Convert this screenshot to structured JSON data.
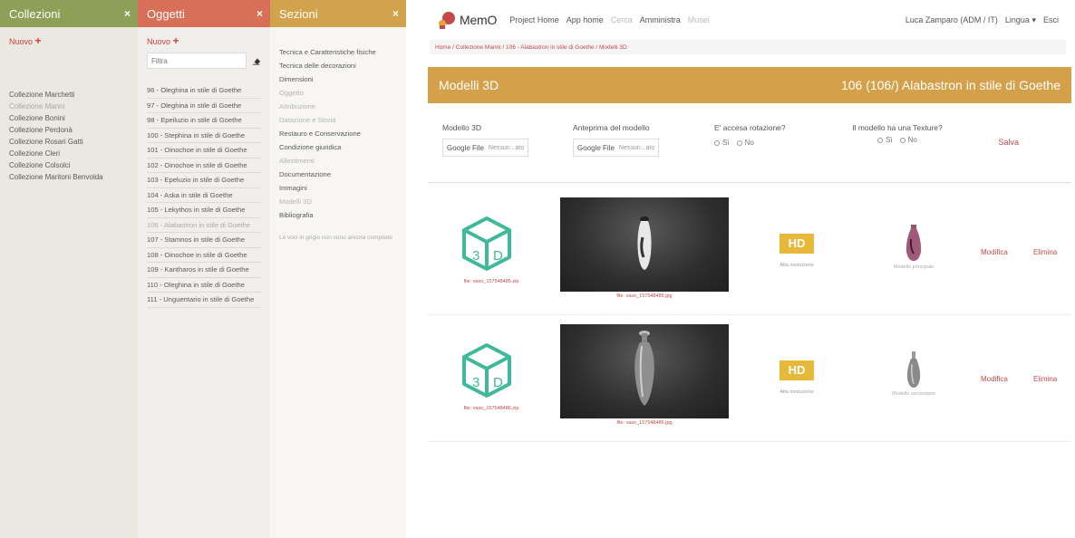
{
  "columns": {
    "collezioni": {
      "title": "Collezioni",
      "close": "×",
      "new_label": "Nuovo",
      "items": [
        {
          "label": "Collezione Marchetti",
          "muted": false
        },
        {
          "label": "Collezione Manni",
          "muted": true
        },
        {
          "label": "Collezione Bonini",
          "muted": false
        },
        {
          "label": "Collezione Perdonà",
          "muted": false
        },
        {
          "label": "Collezione Rosari Gatti",
          "muted": false
        },
        {
          "label": "Collezione Cleri",
          "muted": false
        },
        {
          "label": "Collezione Colsolci",
          "muted": false
        },
        {
          "label": "Collezione Maritoni Benvolda",
          "muted": false
        }
      ]
    },
    "oggetti": {
      "title": "Oggetti",
      "close": "×",
      "new_label": "Nuovo",
      "search_placeholder": "Filtra",
      "items": [
        {
          "label": "96 - Oleghina in stile di Goethe",
          "muted": false
        },
        {
          "label": "97 - Oleghina in stile di Goethe",
          "muted": false
        },
        {
          "label": "98 - Epeiluzio in stile di Goethe",
          "muted": false
        },
        {
          "label": "100 - Stephina in stile di Goethe",
          "muted": false
        },
        {
          "label": "101 - Oinochoe in stile di Goethe",
          "muted": false
        },
        {
          "label": "102 - Oinochoe in stile di Goethe",
          "muted": false
        },
        {
          "label": "103 - Epeluzio in stile di Goethe",
          "muted": false
        },
        {
          "label": "104 - Aska in stile di Goethe",
          "muted": false
        },
        {
          "label": "105 - Lekythos in stile di Goethe",
          "muted": false
        },
        {
          "label": "106 - Alabastron in stile di Goethe",
          "muted": true
        },
        {
          "label": "107 - Stamnos in stile di Goethe",
          "muted": false
        },
        {
          "label": "108 - Oinochoe in stile di Goethe",
          "muted": false
        },
        {
          "label": "109 - Kantharos in stile di Goethe",
          "muted": false
        },
        {
          "label": "110 - Oleghina in stile di Goethe",
          "muted": false
        },
        {
          "label": "111 - Unguentario in stile di Goethe",
          "muted": false
        }
      ]
    },
    "sezioni": {
      "title": "Sezioni",
      "close": "×",
      "items": [
        {
          "label": "Tecnica e Caratteristiche fisiche",
          "muted": false
        },
        {
          "label": "Tecnica delle decorazioni",
          "muted": false
        },
        {
          "label": "Dimensioni",
          "muted": false
        },
        {
          "label": "Oggetto",
          "muted": true
        },
        {
          "label": "Attribuzione",
          "muted": true
        },
        {
          "label": "Datazione e Storia",
          "muted": true
        },
        {
          "label": "Restauro e Conservazione",
          "muted": false
        },
        {
          "label": "Condizione giuridica",
          "muted": false
        },
        {
          "label": "Allestimenti",
          "muted": true
        },
        {
          "label": "Documentazione",
          "muted": false
        },
        {
          "label": "Immagini",
          "muted": false
        },
        {
          "label": "Modelli 3D",
          "muted": true
        },
        {
          "label": "Bibliografia",
          "muted": false
        }
      ],
      "note": "Le voci in grigio non sono ancora compilate"
    }
  },
  "topnav": {
    "logo": "MemO",
    "items": [
      {
        "label": "Project Home",
        "muted": false
      },
      {
        "label": "App home",
        "muted": false
      },
      {
        "label": "Cerca",
        "muted": true
      },
      {
        "label": "Amministra",
        "muted": false
      },
      {
        "label": "Musei",
        "muted": true
      }
    ],
    "user": "Luca Zamparo (ADM / IT)",
    "language": "Lingua",
    "exit": "Esci"
  },
  "breadcrumb": "Home / Collezione Manni / 106 - Alabastron in stile di Goethe / Modelli 3D",
  "title_bar": {
    "left": "Modelli 3D",
    "right": "106 (106/) Alabastron in stile di Goethe"
  },
  "form": {
    "model_label": "Modello 3D",
    "model_button": "Google File",
    "model_file": "Nessun...ato",
    "preview_label": "Anteprima del modello",
    "preview_button": "Google File",
    "preview_file": "Nessun...ato",
    "rotation_label": "E' accesa rotazione?",
    "rotation_options": [
      "Sì",
      "No"
    ],
    "texture_label": "Il modello ha una Texture?",
    "texture_options": [
      "Sì",
      "No"
    ],
    "save": "Salva"
  },
  "models": [
    {
      "file_caption": "file: vaso_157548485.zip",
      "preview_caption": "file: vaso_157548485.jpg",
      "hd_badge": "HD",
      "hd_caption": "Alta risoluzione",
      "thumb_caption": "Modello principale",
      "edit": "Modifica",
      "delete": "Elimina"
    },
    {
      "file_caption": "file: vaso_157548486.zip",
      "preview_caption": "file: vaso_157548486.jpg",
      "hd_badge": "HD",
      "hd_caption": "Alta risoluzione",
      "thumb_caption": "Modello secondario",
      "edit": "Modifica",
      "delete": "Elimina"
    }
  ],
  "colors": {
    "collezioni": "#8e9f58",
    "oggetti": "#d77057",
    "sezioni": "#d3a24c",
    "accent": "#c44a4a",
    "cube": "#3fb99a",
    "hd": "#e7b83a"
  }
}
